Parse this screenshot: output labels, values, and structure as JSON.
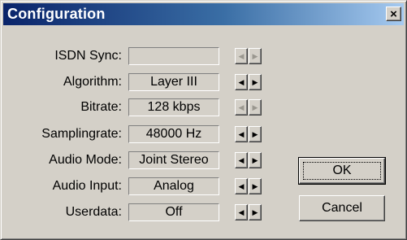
{
  "window": {
    "title": "Configuration",
    "close_glyph": "×"
  },
  "rows": [
    {
      "label": "ISDN Sync:",
      "value": "",
      "controls_enabled": false
    },
    {
      "label": "Algorithm:",
      "value": "Layer III",
      "controls_enabled": true
    },
    {
      "label": "Bitrate:",
      "value": "128 kbps",
      "controls_enabled": false
    },
    {
      "label": "Samplingrate:",
      "value": "48000 Hz",
      "controls_enabled": true
    },
    {
      "label": "Audio Mode:",
      "value": "Joint Stereo",
      "controls_enabled": true
    },
    {
      "label": "Audio Input:",
      "value": "Analog",
      "controls_enabled": true
    },
    {
      "label": "Userdata:",
      "value": "Off",
      "controls_enabled": true
    }
  ],
  "spin_glyphs": {
    "left": "◀",
    "right": "▶"
  },
  "buttons": {
    "ok": "OK",
    "cancel": "Cancel"
  },
  "colors": {
    "face": "#d4d0c8",
    "title_start": "#0a246a",
    "title_end": "#a6caf0",
    "disabled_glyph": "#9a978f"
  }
}
